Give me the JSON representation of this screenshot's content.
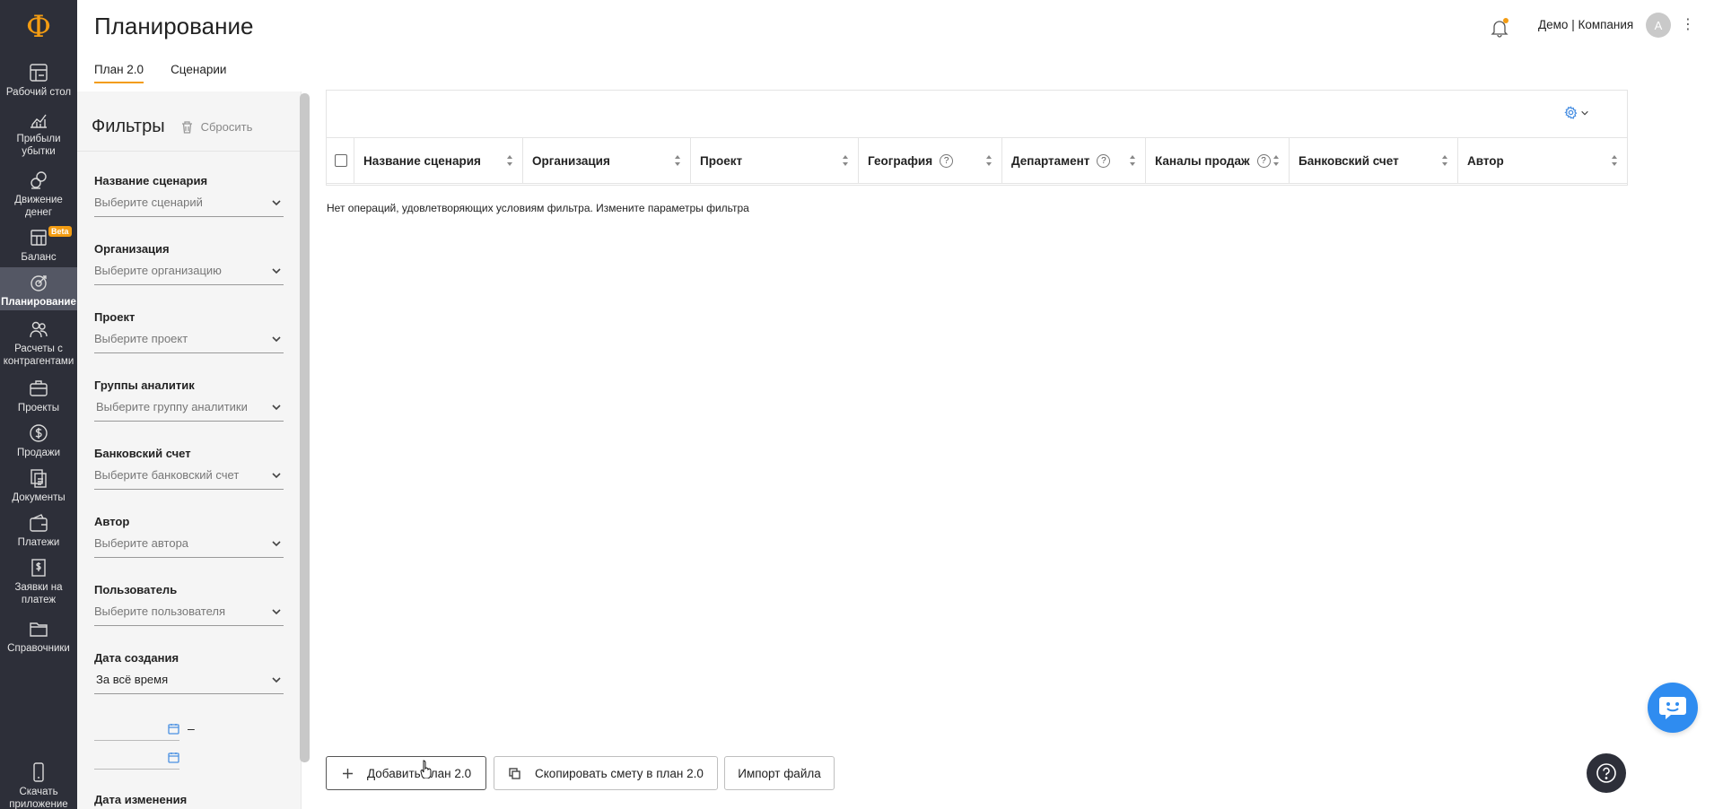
{
  "app": {
    "logo": "Ф",
    "title": "Планирование"
  },
  "sidebar": {
    "items": [
      {
        "label": "Рабочий стол",
        "icon": "dashboard-icon"
      },
      {
        "label": "Прибыли убытки",
        "icon": "profit-chart-icon"
      },
      {
        "label": "Движение денег",
        "icon": "cashflow-icon"
      },
      {
        "label": "Баланс",
        "icon": "balance-icon",
        "badge": "Beta"
      },
      {
        "label": "Планирование",
        "icon": "target-icon",
        "active": true
      },
      {
        "label": "Расчеты с контрагентами",
        "icon": "partners-icon"
      },
      {
        "label": "Проекты",
        "icon": "briefcase-icon"
      },
      {
        "label": "Продажи",
        "icon": "dollar-icon"
      },
      {
        "label": "Документы",
        "icon": "documents-icon"
      },
      {
        "label": "Платежи",
        "icon": "wallet-icon"
      },
      {
        "label": "Заявки на платеж",
        "icon": "payment-request-icon"
      },
      {
        "label": "Справочники",
        "icon": "folder-icon"
      }
    ],
    "download_app": "Скачать приложение"
  },
  "tabs": [
    {
      "label": "План 2.0",
      "active": true
    },
    {
      "label": "Сценарии",
      "active": false
    }
  ],
  "header": {
    "company": "Демо | Компания",
    "avatar_letter": "А"
  },
  "filters": {
    "title": "Фильтры",
    "reset_label": "Сбросить",
    "groups": [
      {
        "label": "Название сценария",
        "placeholder": "Выберите сценарий"
      },
      {
        "label": "Организация",
        "placeholder": "Выберите организацию"
      },
      {
        "label": "Проект",
        "placeholder": "Выберите проект"
      },
      {
        "label": "Группы аналитик",
        "placeholder": "Выберите группу аналитики"
      },
      {
        "label": "Банковский счет",
        "placeholder": "Выберите банковский счет"
      },
      {
        "label": "Автор",
        "placeholder": "Выберите автора"
      },
      {
        "label": "Пользователь",
        "placeholder": "Выберите пользователя"
      },
      {
        "label": "Дата создания",
        "value": "За всё время"
      }
    ],
    "date_range_separator": "–",
    "next_group_label": "Дата изменения"
  },
  "table": {
    "columns": [
      {
        "label": "Название сценария",
        "help": false
      },
      {
        "label": "Организация",
        "help": false
      },
      {
        "label": "Проект",
        "help": false
      },
      {
        "label": "География",
        "help": true
      },
      {
        "label": "Департамент",
        "help": true
      },
      {
        "label": "Каналы продаж",
        "help": true
      },
      {
        "label": "Банковский счет",
        "help": false
      },
      {
        "label": "Автор",
        "help": false
      }
    ],
    "empty_message": "Нет операций, удовлетворяющих условиям фильтра. Измените параметры фильтра"
  },
  "actions": {
    "add_plan": "Добавить план 2.0",
    "copy_estimate": "Скопировать смету в план 2.0",
    "import_file": "Импорт файла"
  },
  "colors": {
    "accent": "#f39c12",
    "sidebar_bg": "#2d2f39",
    "link_blue": "#4a90e2",
    "chat_blue": "#2f8cf0"
  }
}
